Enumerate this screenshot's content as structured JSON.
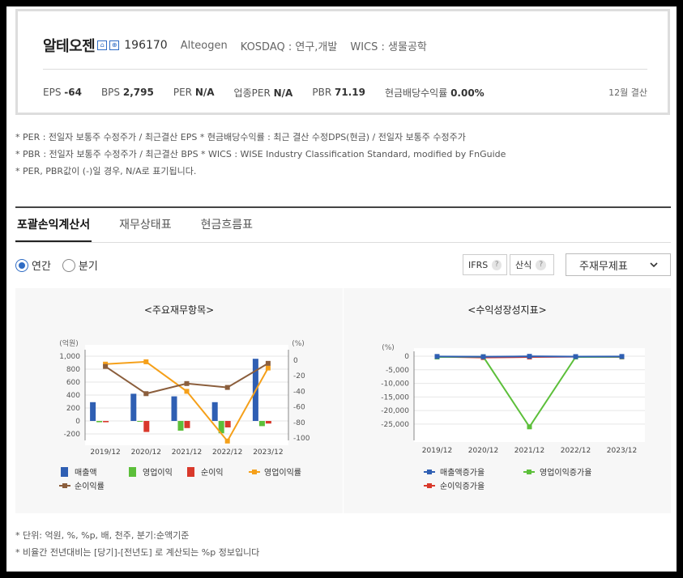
{
  "header": {
    "company_name": "알테오젠",
    "badge1": "⌂",
    "badge2": "⊕",
    "code": "196170",
    "english_name": "Alteogen",
    "market": "KOSDAQ : 연구,개발",
    "wics": "WICS : 생물공학",
    "metrics": [
      {
        "label": "EPS",
        "value": "-64"
      },
      {
        "label": "BPS",
        "value": "2,795"
      },
      {
        "label": "PER",
        "value": "N/A"
      },
      {
        "label": "업종PER",
        "value": "N/A"
      },
      {
        "label": "PBR",
        "value": "71.19"
      },
      {
        "label": "현금배당수익률",
        "value": "0.00%"
      }
    ],
    "settlement": "12월 결산"
  },
  "notes": [
    "* PER : 전일자 보통주 수정주가 / 최근결산 EPS * 현금배당수익률 : 최근 결산 수정DPS(현금) / 전일자 보통주 수정주가",
    "* PBR : 전일자 보통주 수정주가 / 최근결산 BPS * WICS : WISE Industry Classification Standard, modified by FnGuide",
    "* PER, PBR값이 (-)일 경우, N/A로 표기됩니다."
  ],
  "tabs": [
    {
      "label": "포괄손익계산서",
      "active": true
    },
    {
      "label": "재무상태표",
      "active": false
    },
    {
      "label": "현금흐름표",
      "active": false
    }
  ],
  "period": {
    "annual": "연간",
    "quarterly": "분기",
    "selected": "annual"
  },
  "options": {
    "ifrs": "IFRS",
    "calc": "산식",
    "help": "?",
    "select_value": "주재무제표"
  },
  "chart_data": [
    {
      "type": "bar",
      "title": "<주요재무항목>",
      "categories": [
        "2019/12",
        "2020/12",
        "2021/12",
        "2022/12",
        "2023/12"
      ],
      "y_left_label": "(억원)",
      "y_right_label": "(%)",
      "y_left_ticks": [
        "1,000",
        "800",
        "600",
        "400",
        "200",
        "0",
        "-200"
      ],
      "y_right_ticks": [
        "0",
        "-20",
        "-40",
        "-60",
        "-80",
        "-100"
      ],
      "ylim_left": [
        -200,
        1000
      ],
      "ylim_right": [
        -100,
        0
      ],
      "series": [
        {
          "name": "매출액",
          "kind": "bar",
          "axis": "left",
          "color": "#2f5fb3",
          "values": [
            290,
            420,
            380,
            290,
            960
          ]
        },
        {
          "name": "영업이익",
          "kind": "bar",
          "axis": "left",
          "color": "#5cbf3a",
          "values": [
            -20,
            -10,
            -150,
            -190,
            -80
          ]
        },
        {
          "name": "순이익",
          "kind": "bar",
          "axis": "left",
          "color": "#d9392b",
          "values": [
            -20,
            -170,
            -110,
            -100,
            -40
          ]
        },
        {
          "name": "영업이익률",
          "kind": "line",
          "axis": "right",
          "color": "#f5a01a",
          "values": [
            -5,
            -2,
            -40,
            -104,
            -10
          ]
        },
        {
          "name": "순이익률",
          "kind": "line",
          "axis": "right",
          "color": "#8b5e3c",
          "values": [
            -8,
            -43,
            -30,
            -35,
            -4
          ]
        }
      ],
      "legend": "bottom"
    },
    {
      "type": "line",
      "title": "<수익성장성지표>",
      "categories": [
        "2019/12",
        "2020/12",
        "2021/12",
        "2022/12",
        "2023/12"
      ],
      "y_label": "(%)",
      "y_ticks": [
        "0",
        "-5,000",
        "-10,000",
        "-15,000",
        "-20,000",
        "-25,000"
      ],
      "ylim": [
        -28000,
        0
      ],
      "series": [
        {
          "name": "매출액증가율",
          "color": "#2f5fb3",
          "values": [
            -100,
            -200,
            -50,
            -150,
            -100
          ]
        },
        {
          "name": "영업이익증가율",
          "color": "#5cbf3a",
          "values": [
            -300,
            -200,
            -26000,
            -300,
            -200
          ]
        },
        {
          "name": "순이익증가율",
          "color": "#d9392b",
          "values": [
            -200,
            -500,
            -300,
            -200,
            -250
          ]
        }
      ],
      "legend": "bottom"
    }
  ],
  "footer_notes": [
    "* 단위: 억원, %, %p, 배, 천주, 분기:순액기준",
    "* 비율간 전년대비는 [당기]-[전년도] 로 계산되는 %p 정보입니다"
  ]
}
